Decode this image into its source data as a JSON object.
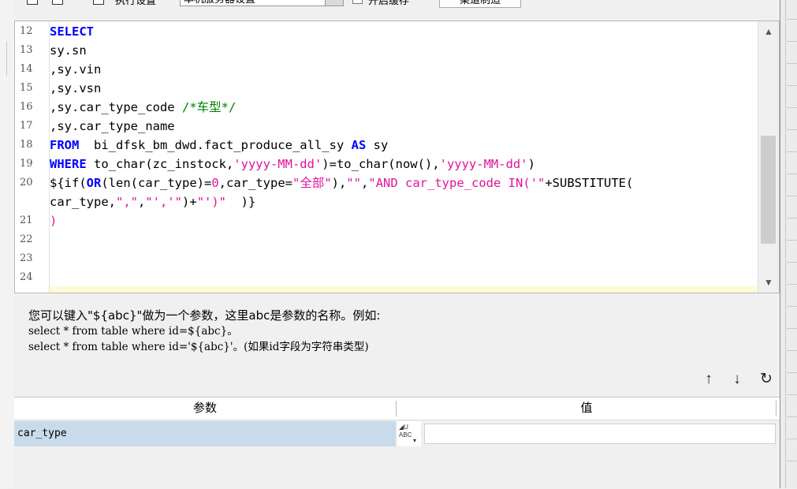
{
  "toolbar": {
    "exec_label": "执行设置",
    "server_select": "本机服务器设置",
    "open_exec_label": "开启缓存",
    "remote_btn": "渠道制造"
  },
  "editor": {
    "lines": [
      {
        "num": "12",
        "html": "<span class=\"kw\">SELECT</span>"
      },
      {
        "num": "13",
        "html": "<span class=\"txt\">sy.sn</span>"
      },
      {
        "num": "14",
        "html": "<span class=\"txt\">,sy.vin</span>"
      },
      {
        "num": "15",
        "html": "<span class=\"txt\">,sy.vsn</span>"
      },
      {
        "num": "16",
        "html": "<span class=\"txt\">,sy.car_type_code </span><span class=\"cm\">/*车型*/</span>"
      },
      {
        "num": "17",
        "html": "<span class=\"txt\">,sy.car_type_name</span>"
      },
      {
        "num": "18",
        "html": "<span class=\"kw\">FROM</span><span class=\"txt\">  bi_dfsk_bm_dwd.fact_produce_all_sy </span><span class=\"kw\">AS</span><span class=\"txt\"> sy</span>"
      },
      {
        "num": "19",
        "html": "<span class=\"kw\">WHERE</span><span class=\"txt\"> to_char(zc_instock,</span><span class=\"str\">'yyyy-MM-dd'</span><span class=\"txt\">)=to_char(now(),</span><span class=\"str\">'yyyy-MM-dd'</span><span class=\"txt\">)</span>"
      },
      {
        "num": "20",
        "html": "<span class=\"txt\">${if(</span><span class=\"kw\">OR</span><span class=\"txt\">(len(car_type)=</span><span class=\"str\">0</span><span class=\"txt\">,car_type=</span><span class=\"str\">\"全部\"</span><span class=\"txt\">),</span><span class=\"str\">\"\"</span><span class=\"txt\">,</span><span class=\"str\">\"AND car_type_code IN('\"</span><span class=\"txt\">+SUBSTITUTE(</span>"
      },
      {
        "num": "",
        "html": "<span class=\"txt\">car_type,</span><span class=\"str\">\",\"</span><span class=\"txt\">,</span><span class=\"str\">\"','\"</span><span class=\"txt\">)+</span><span class=\"str\">\"')\"</span><span class=\"txt\">  )}</span>"
      },
      {
        "num": "21",
        "html": "<span class=\"str\">)</span>"
      },
      {
        "num": "22",
        "html": ""
      },
      {
        "num": "23",
        "html": ""
      },
      {
        "num": "24",
        "html": ""
      }
    ]
  },
  "help": {
    "line1": "您可以键入\"${abc}\"做为一个参数，这里abc是参数的名称。例如:",
    "line2": "select * from table where id=${abc}。",
    "line3": "select * from table where id='${abc}'。(如果id字段为字符串类型)"
  },
  "grid": {
    "col_param": "参数",
    "col_value": "值",
    "rows": [
      {
        "param": "car_type",
        "value": ""
      }
    ]
  },
  "icons": {
    "move_up": "↑",
    "move_down": "↓",
    "refresh": "↻"
  }
}
